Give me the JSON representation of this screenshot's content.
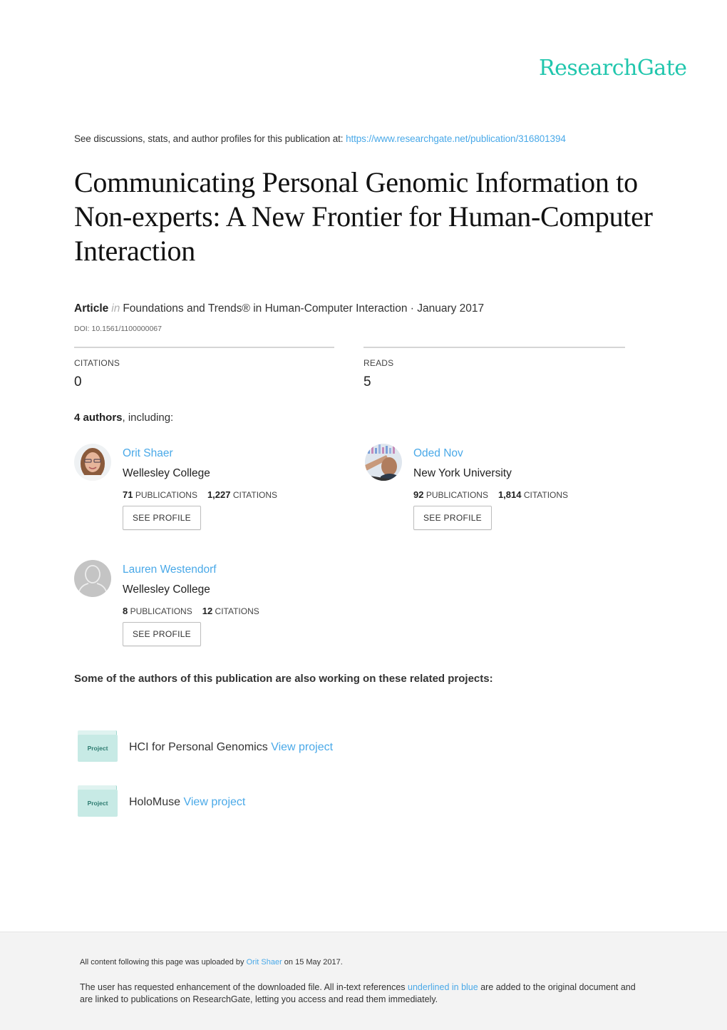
{
  "brand": {
    "name": "ResearchGate",
    "color": "#20c6ad"
  },
  "header": {
    "discussions_text": "See discussions, stats, and author profiles for this publication at: ",
    "publication_url": "https://www.researchgate.net/publication/316801394"
  },
  "publication": {
    "title": "Communicating Personal Genomic Information to Non-experts: A New Frontier for Human-Computer Interaction",
    "type": "Article",
    "in_word": "in",
    "venue_date": "Foundations and Trends® in Human-Computer Interaction · January 2017",
    "doi": "DOI: 10.1561/1100000067"
  },
  "stats": [
    {
      "label": "CITATIONS",
      "value": "0"
    },
    {
      "label": "READS",
      "value": "5"
    }
  ],
  "authors_heading": {
    "count": "4 authors",
    "suffix": ", including:"
  },
  "authors": [
    {
      "name": "Orit Shaer",
      "institution": "Wellesley College",
      "publications": "71",
      "publications_label": "PUBLICATIONS",
      "citations": "1,227",
      "citations_label": "CITATIONS",
      "button": "SEE PROFILE",
      "avatar": "photo"
    },
    {
      "name": "Oded Nov",
      "institution": "New York University",
      "publications": "92",
      "publications_label": "PUBLICATIONS",
      "citations": "1,814",
      "citations_label": "CITATIONS",
      "button": "SEE PROFILE",
      "avatar": "photo"
    },
    {
      "name": "Lauren Westendorf",
      "institution": "Wellesley College",
      "publications": "8",
      "publications_label": "PUBLICATIONS",
      "citations": "12",
      "citations_label": "CITATIONS",
      "button": "SEE PROFILE",
      "avatar": "default-user-icon"
    }
  ],
  "related": {
    "heading": "Some of the authors of this publication are also working on these related projects:",
    "projects": [
      {
        "icon_label": "Project",
        "name": "HCI for Personal Genomics",
        "link": "View project"
      },
      {
        "icon_label": "Project",
        "name": "HoloMuse",
        "link": "View project"
      }
    ]
  },
  "footer": {
    "uploaded_prefix": "All content following this page was uploaded by ",
    "uploader": "Orit Shaer",
    "uploaded_suffix": " on 15 May 2017.",
    "enhancement_prefix": "The user has requested enhancement of the downloaded file. All in-text references ",
    "enhancement_link": "underlined in blue",
    "enhancement_suffix": " are added to the original document and are linked to publications on ResearchGate, letting you access and read them immediately."
  },
  "colors": {
    "link": "#4aa9e8",
    "footer_bg": "#f3f3f3",
    "project_folder": "#c7eae5"
  }
}
